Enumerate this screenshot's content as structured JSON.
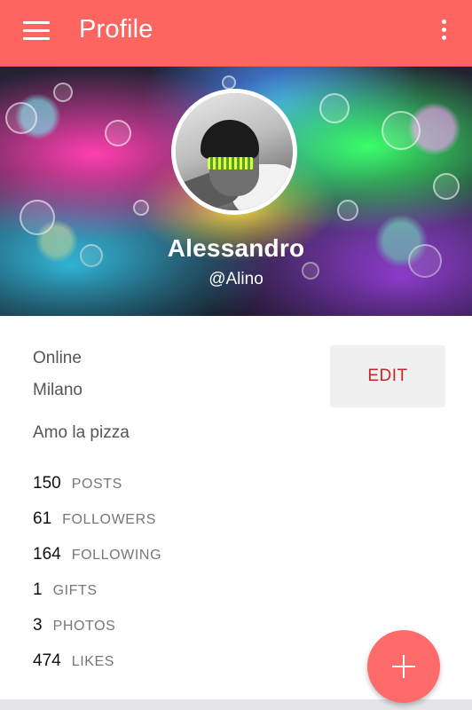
{
  "appbar": {
    "title": "Profile",
    "menu_icon": "hamburger-menu-icon",
    "overflow_icon": "more-vertical-icon",
    "color": "#ff6560"
  },
  "profile": {
    "name": "Alessandro",
    "handle": "@Alino",
    "status": "Online",
    "location": "Milano",
    "bio": "Amo la pizza",
    "edit_label": "EDIT"
  },
  "stats": [
    {
      "value": "150",
      "label": "POSTS"
    },
    {
      "value": "61",
      "label": "FOLLOWERS"
    },
    {
      "value": "164",
      "label": "FOLLOWING"
    },
    {
      "value": "1",
      "label": "GIFTS"
    },
    {
      "value": "3",
      "label": "PHOTOS"
    },
    {
      "value": "474",
      "label": "LIKES"
    }
  ],
  "fab": {
    "icon": "plus-icon",
    "color": "#ff6b6b"
  }
}
